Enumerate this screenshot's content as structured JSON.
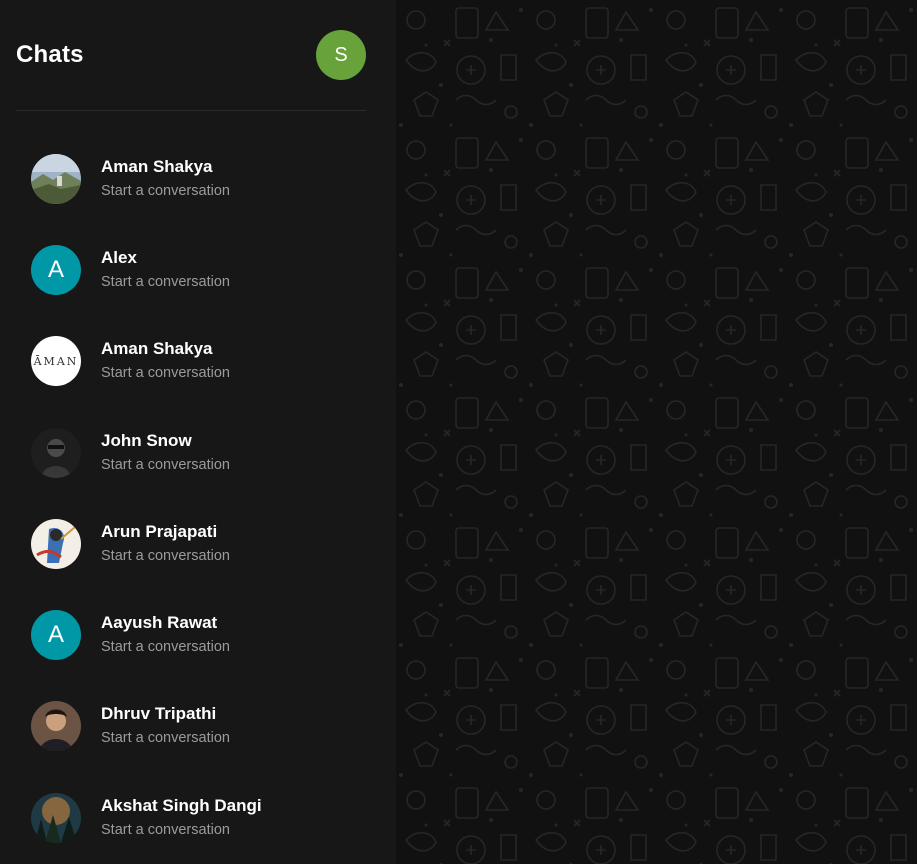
{
  "header": {
    "title": "Chats",
    "profile_initial": "S",
    "profile_color": "#67a33a"
  },
  "colors": {
    "sidebar_bg": "#171717",
    "main_bg": "#111111",
    "letter_avatar_bg": "#0097a7"
  },
  "chats": [
    {
      "name": "Aman Shakya",
      "subtitle": "Start a conversation",
      "avatar": "photo-landscape"
    },
    {
      "name": "Alex",
      "subtitle": "Start a conversation",
      "avatar_letter": "A"
    },
    {
      "name": "Aman Shakya",
      "subtitle": "Start a conversation",
      "avatar_text": "ĀMAN"
    },
    {
      "name": "John Snow",
      "subtitle": "Start a conversation",
      "avatar": "photo-dark-portrait"
    },
    {
      "name": "Arun Prajapati",
      "subtitle": "Start a conversation",
      "avatar": "photo-illustration"
    },
    {
      "name": "Aayush Rawat",
      "subtitle": "Start a conversation",
      "avatar_letter": "A"
    },
    {
      "name": "Dhruv Tripathi",
      "subtitle": "Start a conversation",
      "avatar": "photo-portrait"
    },
    {
      "name": "Akshat Singh Dangi",
      "subtitle": "Start a conversation",
      "avatar": "photo-forest"
    }
  ]
}
